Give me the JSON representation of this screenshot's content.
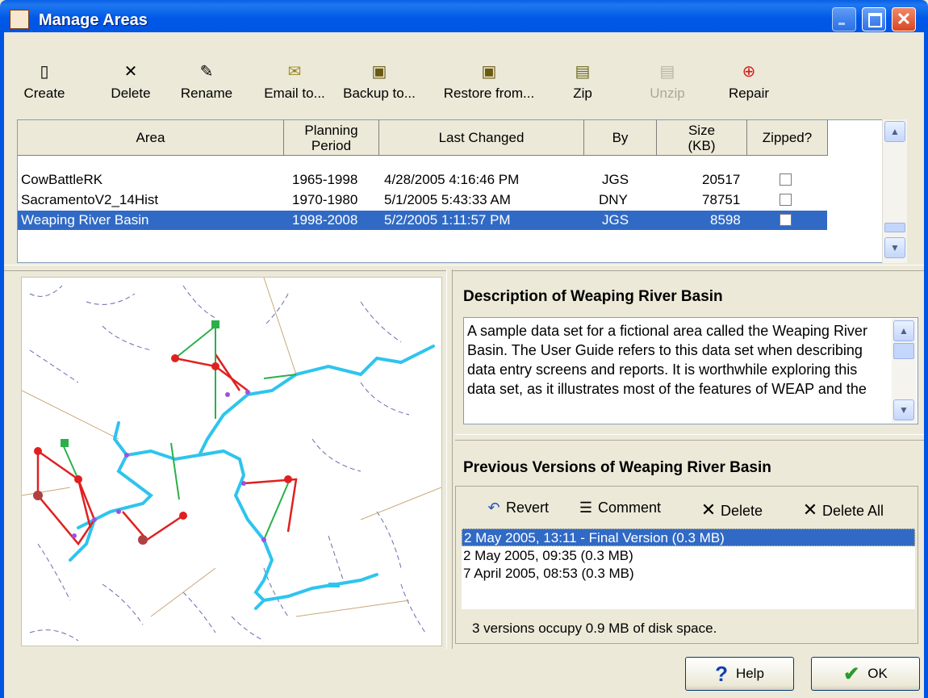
{
  "window": {
    "title": "Manage Areas"
  },
  "toolbar": [
    {
      "label": "Create",
      "icon": "new-document-icon",
      "glyph": "▯",
      "disabled": false
    },
    {
      "label": "Delete",
      "icon": "delete-x-icon",
      "glyph": "✕",
      "disabled": false
    },
    {
      "label": "Rename",
      "icon": "rename-icon",
      "glyph": "✎",
      "disabled": false
    },
    {
      "label": "Email to...",
      "icon": "envelope-icon",
      "glyph": "✉",
      "disabled": false
    },
    {
      "label": "Backup to...",
      "icon": "floppy-disk-icon",
      "glyph": "▣",
      "disabled": false
    },
    {
      "label": "Restore from...",
      "icon": "floppy-restore-icon",
      "glyph": "▣",
      "disabled": false
    },
    {
      "label": "Zip",
      "icon": "zip-icon",
      "glyph": "▤",
      "disabled": false
    },
    {
      "label": "Unzip",
      "icon": "unzip-icon",
      "glyph": "▤",
      "disabled": true
    },
    {
      "label": "Repair",
      "icon": "lifebuoy-icon",
      "glyph": "⊕",
      "disabled": false
    }
  ],
  "grid": {
    "columns": [
      "Area",
      "Planning Period",
      "Last Changed",
      "By",
      "Size (KB)",
      "Zipped?"
    ],
    "rows": [
      {
        "area": "CowBattleRK",
        "period": "1965-1998",
        "changed": "4/28/2005 4:16:46 PM",
        "by": "JGS",
        "size": "20517",
        "zipped": false
      },
      {
        "area": "SacramentoV2_14Hist",
        "period": "1970-1980",
        "changed": "5/1/2005 5:43:33 AM",
        "by": "DNY",
        "size": "78751",
        "zipped": false
      },
      {
        "area": "Weaping River Basin",
        "period": "1998-2008",
        "changed": "5/2/2005 1:11:57 PM",
        "by": "JGS",
        "size": "8598",
        "zipped": false
      }
    ],
    "selected_row": 2
  },
  "description": {
    "title": "Description of Weaping River Basin",
    "text": "A sample data set for a fictional area called the Weaping River Basin. The User Guide refers to this data set when describing data entry screens and reports. It is worthwhile exploring this data set, as it illustrates most of the features of WEAP and the"
  },
  "versions": {
    "title": "Previous Versions of Weaping River Basin",
    "actions": [
      {
        "label": "Revert",
        "icon": "revert-arrow-icon",
        "glyph": "↶"
      },
      {
        "label": "Comment",
        "icon": "comment-icon",
        "glyph": "☰"
      },
      {
        "label": "Delete",
        "icon": "delete-x-icon",
        "glyph": "✕"
      },
      {
        "label": "Delete All",
        "icon": "delete-all-x-icon",
        "glyph": "✕"
      }
    ],
    "items": [
      "2 May 2005, 13:11 - Final Version  (0.3 MB)",
      "2 May 2005, 09:35  (0.3 MB)",
      "7 April 2005, 08:53  (0.3 MB)"
    ],
    "selected": 0,
    "status": "3 versions occupy 0.9 MB of disk space."
  },
  "buttons": {
    "help": "Help",
    "ok": "OK"
  },
  "colors": {
    "selection": "#316ac5",
    "river": "#2ec4ee",
    "transmission": "#e02020",
    "return_flow": "#2ab04a",
    "titlebar": "#0054e3"
  }
}
